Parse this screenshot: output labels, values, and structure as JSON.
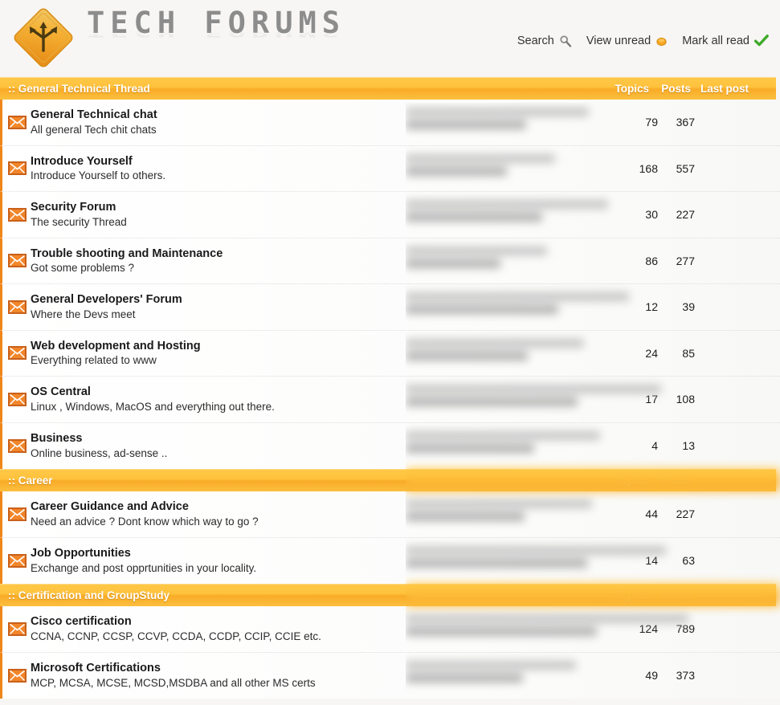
{
  "site": {
    "title": "TECH FORUMS",
    "logo_icon": "diamond-road-sign-arrows-icon",
    "background_color": "#f7f6f4",
    "accent_color": "#f9ab27",
    "icon_color": "#f0861a"
  },
  "header_nav": [
    {
      "label": "Search",
      "icon": "magnifier-icon",
      "icon_color": "#8a8a8a"
    },
    {
      "label": "View unread",
      "icon": "orange-dot-icon",
      "icon_color": "#f5a623"
    },
    {
      "label": "Mark all read",
      "icon": "green-check-icon",
      "icon_color": "#3faa2a"
    }
  ],
  "columns": {
    "topics": "Topics",
    "posts": "Posts",
    "last_post": "Last post"
  },
  "categories": [
    {
      "title": ":: General Technical Thread",
      "show_last_post_header": true,
      "forums": [
        {
          "name": "General Technical chat",
          "desc": "All general Tech chit chats",
          "topics": "79",
          "posts": "367",
          "icon": "envelope-icon"
        },
        {
          "name": "Introduce Yourself",
          "desc": "Introduce Yourself to others.",
          "topics": "168",
          "posts": "557",
          "icon": "envelope-icon"
        },
        {
          "name": "Security Forum",
          "desc": "The security Thread",
          "topics": "30",
          "posts": "227",
          "icon": "envelope-icon"
        },
        {
          "name": "Trouble shooting and Maintenance",
          "desc": "Got some problems ?",
          "topics": "86",
          "posts": "277",
          "icon": "envelope-icon"
        },
        {
          "name": "General Developers' Forum",
          "desc": "Where the Devs meet",
          "topics": "12",
          "posts": "39",
          "icon": "envelope-icon"
        },
        {
          "name": "Web development and Hosting",
          "desc": "Everything related to www",
          "topics": "24",
          "posts": "85",
          "icon": "envelope-icon"
        },
        {
          "name": "OS Central",
          "desc": "Linux , Windows, MacOS and everything out there.",
          "topics": "17",
          "posts": "108",
          "icon": "envelope-icon"
        },
        {
          "name": "Business",
          "desc": "Online business, ad-sense ..",
          "topics": "4",
          "posts": "13",
          "icon": "envelope-icon"
        }
      ]
    },
    {
      "title": ":: Career",
      "show_last_post_header": false,
      "forums": [
        {
          "name": "Career Guidance and Advice",
          "desc": "Need an advice ? Dont know which way to go ?",
          "topics": "44",
          "posts": "227",
          "icon": "envelope-icon"
        },
        {
          "name": "Job Opportunities",
          "desc": "Exchange and post opprtunities in your locality.",
          "topics": "14",
          "posts": "63",
          "icon": "envelope-icon"
        }
      ]
    },
    {
      "title": ":: Certification and GroupStudy",
      "show_last_post_header": false,
      "forums": [
        {
          "name": "Cisco certification",
          "desc": "CCNA, CCNP, CCSP, CCVP, CCDA, CCDP, CCIP, CCIE etc.",
          "topics": "124",
          "posts": "789",
          "icon": "envelope-icon"
        },
        {
          "name": "Microsoft Certifications",
          "desc": "MCP, MCSA, MCSE, MCSD,MSDBA and all other MS certs",
          "topics": "49",
          "posts": "373",
          "icon": "envelope-icon"
        }
      ]
    }
  ]
}
